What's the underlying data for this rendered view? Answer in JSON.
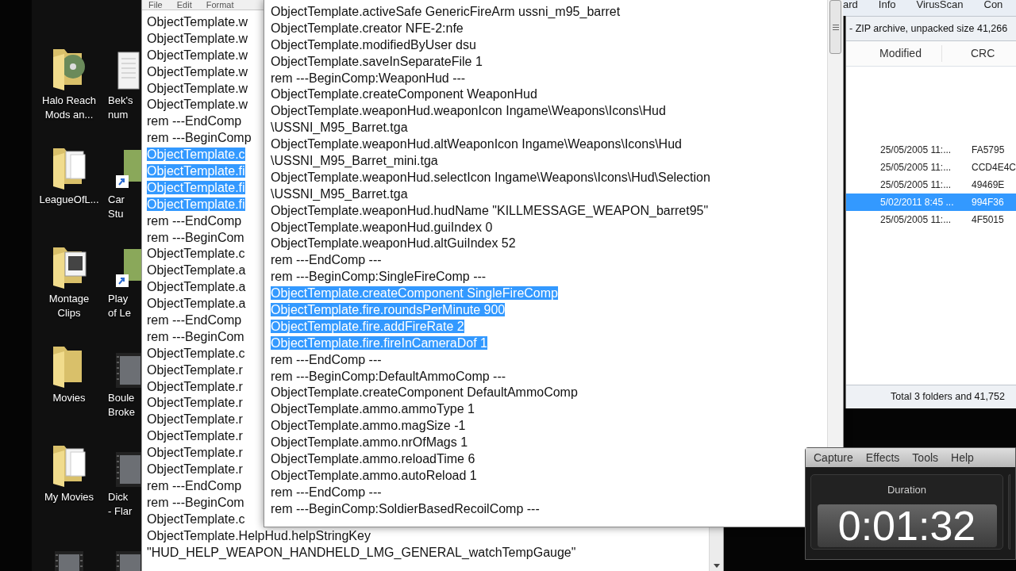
{
  "desktop_icons": [
    {
      "kind": "folder-disc",
      "lines": [
        "Halo Reach",
        "Mods an..."
      ]
    },
    {
      "kind": "document",
      "lines": [
        "Bek's",
        "num"
      ]
    },
    {
      "kind": "folder-papers",
      "lines": [
        "LeagueOfL..."
      ]
    },
    {
      "kind": "shortcut",
      "lines": [
        "Car",
        "Stu"
      ]
    },
    {
      "kind": "folder-picture",
      "lines": [
        "Montage",
        "Clips"
      ]
    },
    {
      "kind": "shortcut",
      "lines": [
        "Play",
        "of Le"
      ]
    },
    {
      "kind": "folder",
      "lines": [
        "Movies"
      ]
    },
    {
      "kind": "video",
      "lines": [
        "Boule",
        "Broke"
      ]
    },
    {
      "kind": "folder-papers",
      "lines": [
        "My Movies"
      ]
    },
    {
      "kind": "video",
      "lines": [
        "Dick",
        "- Flar"
      ]
    },
    {
      "kind": "video"
    },
    {
      "kind": "video"
    }
  ],
  "back_notepad": {
    "menu": [
      "File",
      "Edit",
      "Format"
    ],
    "lines": [
      {
        "text": "ObjectTemplate.w",
        "selected": false
      },
      {
        "text": "ObjectTemplate.w",
        "selected": false
      },
      {
        "text": "ObjectTemplate.w",
        "selected": false
      },
      {
        "text": "ObjectTemplate.w",
        "selected": false
      },
      {
        "text": "ObjectTemplate.w",
        "selected": false
      },
      {
        "text": "ObjectTemplate.w",
        "selected": false
      },
      {
        "text": "rem ---EndComp",
        "selected": false
      },
      {
        "text": "rem ---BeginComp",
        "selected": false
      },
      {
        "text": "ObjectTemplate.c",
        "selected": true
      },
      {
        "text": "ObjectTemplate.fi",
        "selected": true
      },
      {
        "text": "ObjectTemplate.fi",
        "selected": true
      },
      {
        "text": "ObjectTemplate.fi",
        "selected": true
      },
      {
        "text": "rem ---EndComp",
        "selected": false
      },
      {
        "text": "rem ---BeginCom",
        "selected": false
      },
      {
        "text": "ObjectTemplate.c",
        "selected": false
      },
      {
        "text": "ObjectTemplate.a",
        "selected": false
      },
      {
        "text": "ObjectTemplate.a",
        "selected": false
      },
      {
        "text": "ObjectTemplate.a",
        "selected": false
      },
      {
        "text": "rem ---EndComp",
        "selected": false
      },
      {
        "text": "rem ---BeginCom",
        "selected": false
      },
      {
        "text": "ObjectTemplate.c",
        "selected": false
      },
      {
        "text": "ObjectTemplate.r",
        "selected": false
      },
      {
        "text": "ObjectTemplate.r",
        "selected": false
      },
      {
        "text": "ObjectTemplate.r",
        "selected": false
      },
      {
        "text": "ObjectTemplate.r",
        "selected": false
      },
      {
        "text": "ObjectTemplate.r",
        "selected": false
      },
      {
        "text": "ObjectTemplate.r",
        "selected": false
      },
      {
        "text": "ObjectTemplate.r",
        "selected": false
      },
      {
        "text": "rem ---EndComp",
        "selected": false
      },
      {
        "text": "rem ---BeginCom",
        "selected": false
      },
      {
        "text": "ObjectTemplate.c",
        "selected": false
      },
      {
        "text": "ObjectTemplate.HelpHud.helpStringKey",
        "selected": false
      },
      {
        "text": "\"HUD_HELP_WEAPON_HANDHELD_LMG_GENERAL_watchTempGauge\"",
        "selected": false
      }
    ]
  },
  "front_notepad": {
    "lines": [
      {
        "text": "ObjectTemplate.activeSafe GenericFireArm ussni_m95_barret",
        "selected": false
      },
      {
        "text": "ObjectTemplate.creator NFE-2:nfe",
        "selected": false
      },
      {
        "text": "ObjectTemplate.modifiedByUser dsu",
        "selected": false
      },
      {
        "text": "ObjectTemplate.saveInSeparateFile 1",
        "selected": false
      },
      {
        "text": "rem ---BeginComp:WeaponHud ---",
        "selected": false
      },
      {
        "text": "ObjectTemplate.createComponent WeaponHud",
        "selected": false
      },
      {
        "text": "ObjectTemplate.weaponHud.weaponIcon Ingame\\Weapons\\Icons\\Hud",
        "selected": false
      },
      {
        "text": "\\USSNI_M95_Barret.tga",
        "selected": false
      },
      {
        "text": "ObjectTemplate.weaponHud.altWeaponIcon Ingame\\Weapons\\Icons\\Hud",
        "selected": false
      },
      {
        "text": "\\USSNI_M95_Barret_mini.tga",
        "selected": false
      },
      {
        "text": "ObjectTemplate.weaponHud.selectIcon Ingame\\Weapons\\Icons\\Hud\\Selection",
        "selected": false
      },
      {
        "text": "\\USSNI_M95_Barret.tga",
        "selected": false
      },
      {
        "text": "ObjectTemplate.weaponHud.hudName \"KILLMESSAGE_WEAPON_barret95\"",
        "selected": false
      },
      {
        "text": "ObjectTemplate.weaponHud.guiIndex 0",
        "selected": false
      },
      {
        "text": "ObjectTemplate.weaponHud.altGuiIndex 52",
        "selected": false
      },
      {
        "text": "rem ---EndComp ---",
        "selected": false
      },
      {
        "text": "rem ---BeginComp:SingleFireComp ---",
        "selected": false
      },
      {
        "text": "ObjectTemplate.createComponent SingleFireComp",
        "selected": true
      },
      {
        "text": "ObjectTemplate.fire.roundsPerMinute 900",
        "selected": true
      },
      {
        "text": "ObjectTemplate.fire.addFireRate 2",
        "selected": true
      },
      {
        "text": "ObjectTemplate.fire.fireInCameraDof 1",
        "selected": true
      },
      {
        "text": "rem ---EndComp ---",
        "selected": false
      },
      {
        "text": "rem ---BeginComp:DefaultAmmoComp ---",
        "selected": false
      },
      {
        "text": "ObjectTemplate.createComponent DefaultAmmoComp",
        "selected": false
      },
      {
        "text": "ObjectTemplate.ammo.ammoType 1",
        "selected": false
      },
      {
        "text": "ObjectTemplate.ammo.magSize -1",
        "selected": false
      },
      {
        "text": "ObjectTemplate.ammo.nrOfMags 1",
        "selected": false
      },
      {
        "text": "ObjectTemplate.ammo.reloadTime 6",
        "selected": false
      },
      {
        "text": "ObjectTemplate.ammo.autoReload 1",
        "selected": false
      },
      {
        "text": "rem ---EndComp ---",
        "selected": false
      },
      {
        "text": "rem ---BeginComp:SoldierBasedRecoilComp ---",
        "selected": false
      }
    ]
  },
  "archive_window": {
    "toolbar": [
      "ard",
      "Info",
      "VirusScan",
      "Con"
    ],
    "info": "- ZIP archive, unpacked size 41,266",
    "columns": [
      "Modified",
      "CRC"
    ],
    "rows": [
      {
        "modified": "25/05/2005 11:...",
        "crc": "FA5795",
        "selected": false
      },
      {
        "modified": "25/05/2005 11:...",
        "crc": "CCD4E4C",
        "selected": false
      },
      {
        "modified": "25/05/2005 11:...",
        "crc": "49469E",
        "selected": false
      },
      {
        "modified": "5/02/2011 8:45 ...",
        "crc": "994F36",
        "selected": true
      },
      {
        "modified": "25/05/2005 11:...",
        "crc": "4F5015",
        "selected": false
      }
    ],
    "status": "Total 3 folders and 41,752"
  },
  "recorder": {
    "menu": [
      "Capture",
      "Effects",
      "Tools",
      "Help"
    ],
    "duration_label": "Duration",
    "duration": "0:01:32"
  }
}
